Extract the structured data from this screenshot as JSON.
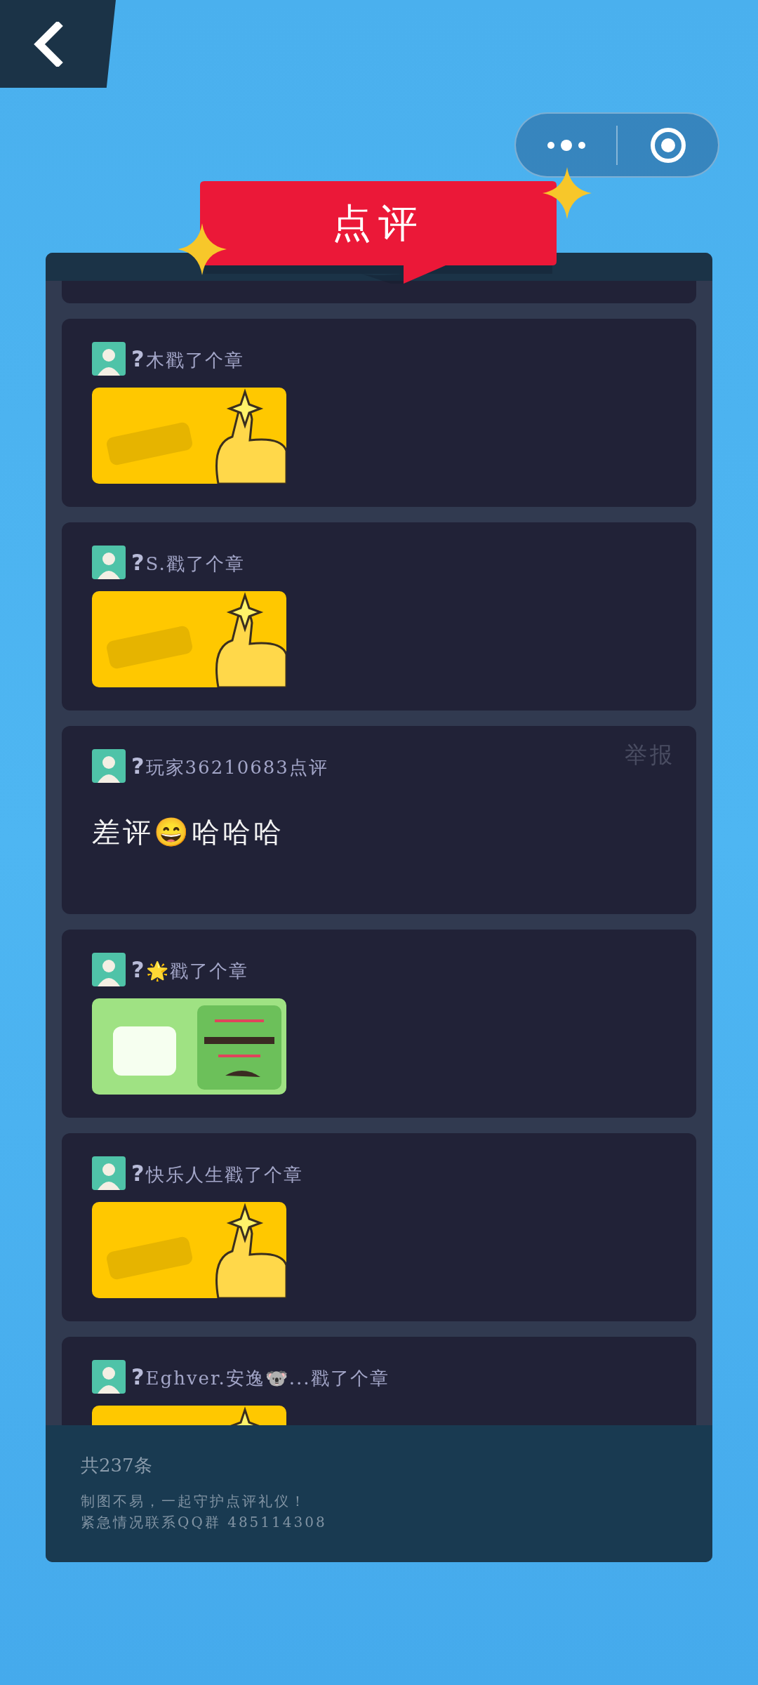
{
  "title": "点评",
  "reviews": [
    {
      "kind": "sticker",
      "user": "**?**木戳了个章",
      "sticker": {
        "kind": "thumbs"
      }
    },
    {
      "kind": "sticker",
      "user": "**?**S.戳了个章",
      "sticker": {
        "kind": "thumbs"
      }
    },
    {
      "kind": "comment",
      "user": "**?**玩家36210683点评",
      "text": "差评😄哈哈哈",
      "report": "举报"
    },
    {
      "kind": "sticker",
      "user": "**?**🌟戳了个章",
      "sticker": {
        "kind": "grumpy"
      }
    },
    {
      "kind": "sticker",
      "user": "**?**快乐人生戳了个章",
      "sticker": {
        "kind": "thumbs"
      }
    },
    {
      "kind": "sticker",
      "user": "**?**Eghver.安逸🐨...戳了个章",
      "sticker": {
        "kind": "thumbs"
      }
    }
  ],
  "footer": {
    "count": "共237条",
    "notes": [
      "制图不易，一起守护点评礼仪！",
      "紧急情况联系QQ群 485114308"
    ]
  }
}
